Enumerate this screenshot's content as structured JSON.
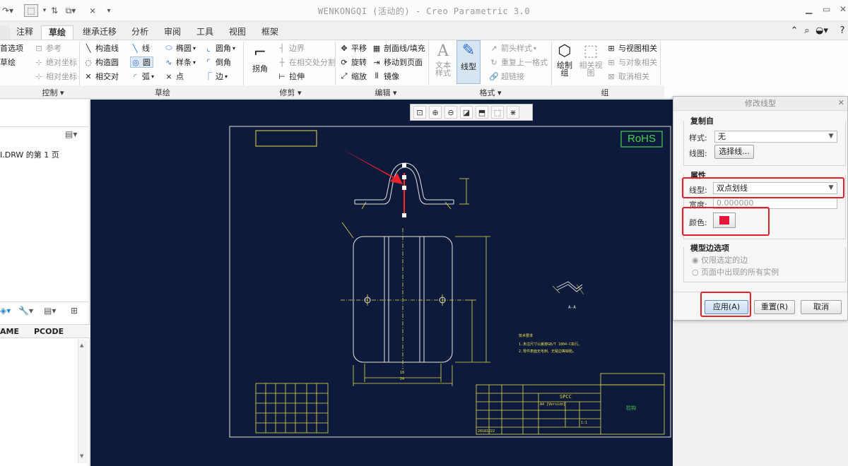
{
  "window": {
    "title": "WENKONGQI (活动的) - Creo Parametric 3.0"
  },
  "tabs": [
    {
      "label": "注释"
    },
    {
      "label": "草绘"
    },
    {
      "label": "继承迁移"
    },
    {
      "label": "分析"
    },
    {
      "label": "审阅"
    },
    {
      "label": "工具"
    },
    {
      "label": "视图"
    },
    {
      "label": "框架"
    }
  ],
  "ribbon": {
    "control": {
      "items": [
        "首选项",
        "草绘",
        "参考",
        "绝对坐标",
        "相对坐标"
      ],
      "label": "控制"
    },
    "sketch": {
      "items": [
        "构造线",
        "构造圆",
        "相交对",
        "线",
        "圆",
        "弧",
        "椭圆",
        "样条",
        "点",
        "圆角",
        "倒角",
        "边"
      ],
      "label": "草绘"
    },
    "trim": {
      "corner": "拐角",
      "items": [
        "边界",
        "在相交处分割",
        "拉伸"
      ],
      "label": "修剪"
    },
    "edit": {
      "items": [
        "平移",
        "剖面线/填充",
        "旋转",
        "移动到页面",
        "缩放",
        "镜像"
      ],
      "label": "编辑"
    },
    "format": {
      "text_style": "文本\n样式",
      "line_style": "线型",
      "items": [
        "箭头样式",
        "重复上一格式",
        "超链接"
      ],
      "label": "格式"
    },
    "group": {
      "draw_group": "绘制\n组",
      "related_view": "相关视\n图",
      "items": [
        "与视图相关",
        "与对象相关",
        "取消相关"
      ],
      "label": "组"
    }
  },
  "left_panel": {
    "file_label": "I.DRW 的第 1 页",
    "col_name": "AME",
    "col_pcode": "PCODE"
  },
  "drawing": {
    "rohs": "RoHS",
    "section": "A-A",
    "dim_width": "18",
    "dim_width2": "24",
    "material": "SPCC",
    "notes_title": "技术要求",
    "note1": "1.未注尺寸公差按GB/T 1804-C执行。",
    "note2": "2.零件表面无毛刺、无锐边等缺陷。",
    "part_name": "拉钩",
    "version": "A4 [Version]",
    "date": "20181222",
    "scale": "1:1"
  },
  "dialog": {
    "title": "修改线型",
    "copy_from": "复制自",
    "style_label": "样式:",
    "style_value": "无",
    "line_label": "线图:",
    "select_line_btn": "选择线...",
    "properties": "属性",
    "linetype_label": "线型:",
    "linetype_value": "双点划线",
    "width_label": "宽度:",
    "width_value": "0.000000",
    "color_label": "颜色:",
    "color_value": "#e4143a",
    "model_edge": "模型边选项",
    "radio1": "仅限选定的边",
    "radio2": "页面中出现的所有实例",
    "apply": "应用(A)",
    "reset": "重置(R)",
    "cancel": "取消"
  },
  "status_bar": "",
  "colors": {
    "canvas_bg": "#0e1a3c",
    "sheet_line": "#e6e2d0",
    "drawing_line": "#e0dc47",
    "rohs": "#43d34a",
    "highlight": "#e2222a"
  }
}
